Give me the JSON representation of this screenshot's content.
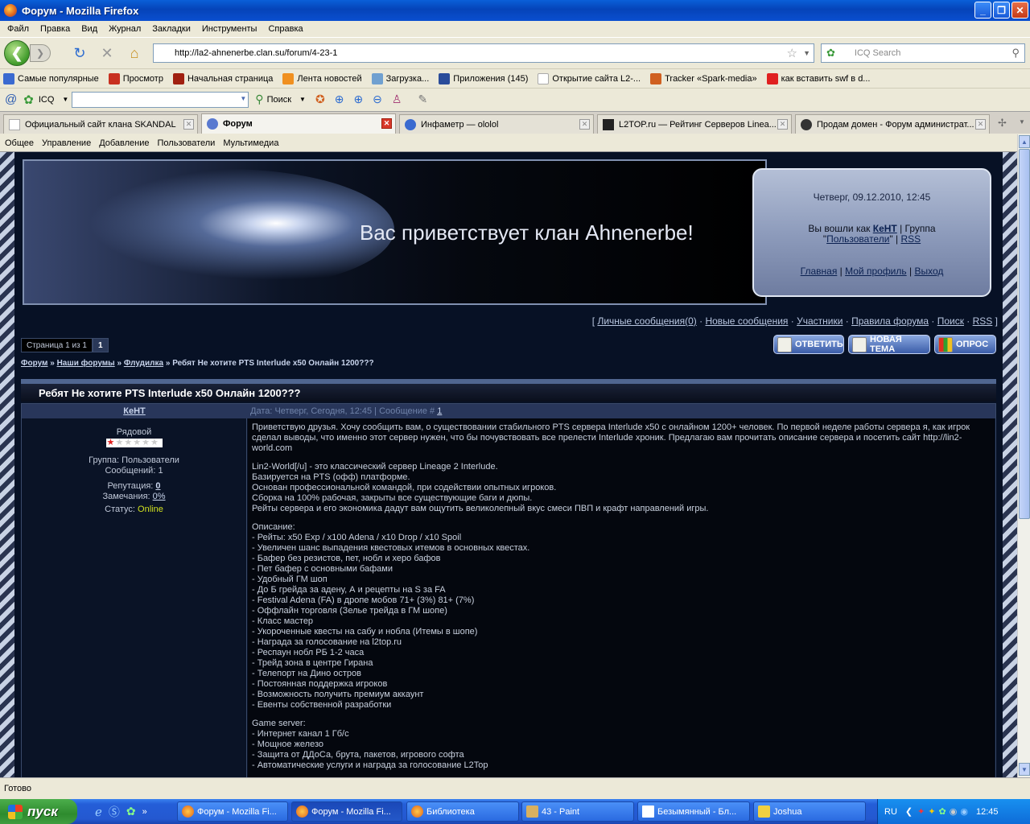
{
  "window": {
    "title": "Форум - Mozilla Firefox",
    "btn_min": "_",
    "btn_max": "❐",
    "btn_close": "✕"
  },
  "menu": [
    "Файл",
    "Правка",
    "Вид",
    "Журнал",
    "Закладки",
    "Инструменты",
    "Справка"
  ],
  "nav": {
    "url": "http://la2-ahnenerbe.clan.su/forum/4-23-1",
    "search_placeholder": "ICQ Search",
    "back": "❮",
    "fwd": "❯"
  },
  "bookmarks": [
    "Самые популярные",
    "Просмотр",
    "Начальная страница",
    "Лента новостей",
    "Загрузка...",
    "Приложения (145)",
    "Открытие сайта L2-...",
    "Tracker «Spark-media»",
    "как вставить swf в d..."
  ],
  "icqbar": {
    "label": "ICQ",
    "search_btn": "Поиск"
  },
  "tabs": [
    "Официальный сайт клана SKANDAL",
    "Форум",
    "Инфаметр — ololol",
    "L2TOP.ru — Рейтинг Серверов Linea...",
    "Продам домен - Форум администрат..."
  ],
  "sitemenu": [
    "Общее",
    "Управление",
    "Добавление",
    "Пользователи",
    "Мультимедиа"
  ],
  "banner": {
    "welcome": "Вас приветствует клан Ahnenerbe!"
  },
  "infobox": {
    "date": "Четверг, 09.12.2010, 12:45",
    "logged_prefix": "Вы вошли как ",
    "user": "КеНТ",
    "group_prefix": " | Группа",
    "group": "Пользователи",
    "rss": "RSS",
    "links": [
      "Главная",
      "Мой профиль",
      "Выход"
    ]
  },
  "toplinks": [
    "Личные сообщения(0)",
    "Новые сообщения",
    "Участники",
    "Правила форума",
    "Поиск",
    "RSS"
  ],
  "pager": {
    "text": "Страница 1 из 1",
    "current": "1"
  },
  "actions": [
    "ОТВЕТИТЬ",
    "НОВАЯ ТЕМА",
    "ОПРОС"
  ],
  "breadcrumbs": [
    "Форум",
    "Наши форумы",
    "Флудилка"
  ],
  "breadcrumb_current": "Ребят Не хотите PTS Interlude x50 Онлайн 1200???",
  "topic": {
    "title": "Ребят Не хотите PTS Interlude x50 Онлайн 1200???"
  },
  "post": {
    "author": "КеНТ",
    "rank": "Рядовой",
    "group": "Группа: Пользователи",
    "messages": "Сообщений: 1",
    "rep_label": "Репутация: ",
    "rep": "0",
    "warn_label": "Замечания: ",
    "warn": "0%",
    "status_label": "Статус: ",
    "status": "Online",
    "date": "Дата: Четверг, Сегодня, 12:45 | Сообщение # ",
    "num": "1",
    "p1": "Приветствую друзья. Хочу сообщить вам, о существовании стабильного PTS сервера Interlude x50 с онлайном 1200+ человек. По первой неделе работы сервера я, как игрок сделал выводы, что именно этот сервер нужен, что бы почувствовать все прелести Interlude хроник. Предлагаю вам прочитать описание сервера и посетить сайт http://lin2-world.com",
    "p2": [
      "Lin2-World[/u] - это классический сервер Lineage 2 Interlude.",
      "Базируется на PTS (офф) платформе.",
      "Основан профессиональной командой, при содействии опытных игроков.",
      "Сборка на 100% рабочая, закрыты все существующие баги и дюпы.",
      "Рейты сервера и его экономика дадут вам ощутить великолепный вкус смеси ПВП и крафт направлений игры."
    ],
    "p3": [
      "Описание:",
      "- Рейты: x50 Exp / x100 Adena / x10 Drop / x10 Spoil",
      "- Увеличен шанс выпадения квестовых итемов в основных квестах.",
      "- Бафер без резистов, пет, нобл и херо бафов",
      "- Пет бафер с основными бафами",
      "- Удобный ГМ шоп",
      "- До Б грейда за адену, А и рецепты на S за FA",
      "- Festival Adena (FA) в дропе мобов 71+ (3%) 81+ (7%)",
      "- Оффлайн торговля (Зелье трейда в ГМ шопе)",
      "- Класс мастер",
      "- Укороченные квесты на сабу и нобла (Итемы в шопе)",
      "- Награда за голосование на l2top.ru",
      "- Респаун нобл РБ 1-2 часа",
      "- Трейд зона в центре Гирана",
      "- Телепорт на Дино остров",
      "- Постоянная поддержка игроков",
      "- Возможность получить премиум аккаунт",
      "- Евенты собственной разработки"
    ],
    "p4": [
      "Game server:",
      "- Интернет канал 1 Гб/с",
      "- Мощное железо",
      "- Защита от ДДоСа, брута, пакетов, игрового софта",
      "- Автоматические услуги и награда за голосование L2Top"
    ]
  },
  "status": "Готово",
  "taskbar": {
    "start": "пуск",
    "buttons": [
      "Форум - Mozilla Fi...",
      "Форум - Mozilla Fi...",
      "Библиотека",
      "43 - Paint",
      "Безымянный - Бл...",
      "Joshua"
    ],
    "lang": "RU",
    "time": "12:45"
  }
}
